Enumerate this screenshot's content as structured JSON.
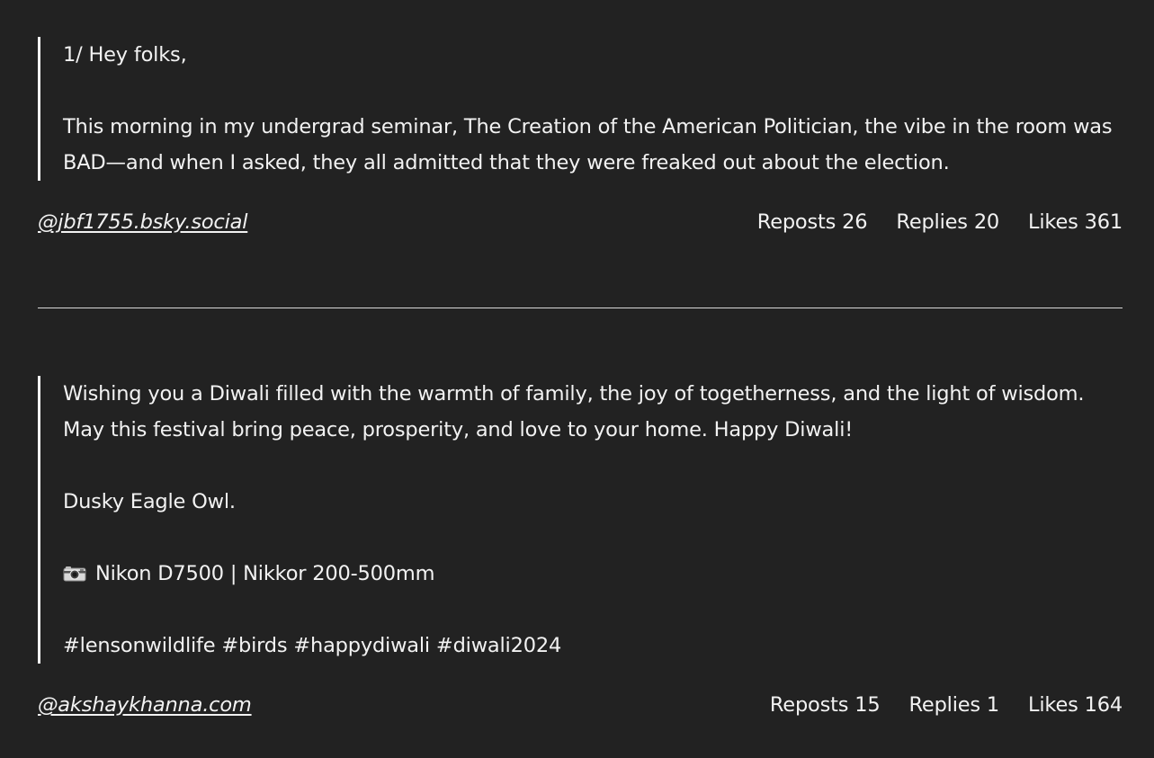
{
  "posts": [
    {
      "paragraphs": [
        "1/ Hey folks,",
        "This morning in my undergrad seminar, The Creation of the American Politician, the vibe in the room was BAD—and when I asked, they all admitted that they were freaked out about the election."
      ],
      "handle": "@jbf1755.bsky.social",
      "reposts_label": "Reposts",
      "reposts": "26",
      "replies_label": "Replies",
      "replies": "20",
      "likes_label": "Likes",
      "likes": "361"
    },
    {
      "paragraphs": [
        "Wishing you a Diwali filled with the warmth of family, the joy of togetherness, and the light of wisdom. May this festival bring peace, prosperity, and love to your home. Happy Diwali!",
        "Dusky Eagle Owl.",
        "Nikon D7500 | Nikkor 200-500mm",
        "#lensonwildlife #birds #happydiwali #diwali2024"
      ],
      "camera_icon": "camera-icon",
      "handle": "@akshaykhanna.com",
      "reposts_label": "Reposts",
      "reposts": "15",
      "replies_label": "Replies",
      "replies": "1",
      "likes_label": "Likes",
      "likes": "164"
    }
  ],
  "colors": {
    "background": "#222222",
    "text": "#f2f2f2",
    "divider": "#d8d8d8"
  }
}
